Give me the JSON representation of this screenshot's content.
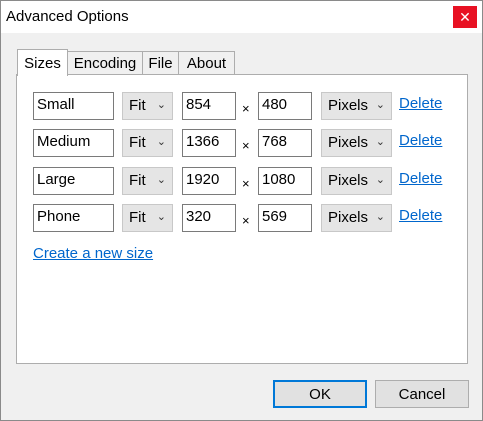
{
  "window": {
    "title": "Advanced Options",
    "close_glyph": "✕"
  },
  "tabs": [
    {
      "label": "Sizes",
      "active": true
    },
    {
      "label": "Encoding",
      "active": false
    },
    {
      "label": "File",
      "active": false
    },
    {
      "label": "About",
      "active": false
    }
  ],
  "sizes": [
    {
      "name": "Small",
      "mode": "Fit",
      "width": "854",
      "height": "480",
      "unit": "Pixels",
      "delete_label": "Delete"
    },
    {
      "name": "Medium",
      "mode": "Fit",
      "width": "1366",
      "height": "768",
      "unit": "Pixels",
      "delete_label": "Delete"
    },
    {
      "name": "Large",
      "mode": "Fit",
      "width": "1920",
      "height": "1080",
      "unit": "Pixels",
      "delete_label": "Delete"
    },
    {
      "name": "Phone",
      "mode": "Fit",
      "width": "320",
      "height": "569",
      "unit": "Pixels",
      "delete_label": "Delete"
    }
  ],
  "times_symbol": "×",
  "chevron_glyph": "⌄",
  "create_link": "Create a new size",
  "buttons": {
    "ok": "OK",
    "cancel": "Cancel"
  },
  "colors": {
    "close_button": "#e81123",
    "link": "#0066cc",
    "default_button_border": "#0078d7"
  },
  "icons": {
    "close": "close-icon",
    "dropdown": "chevron-down-icon"
  }
}
